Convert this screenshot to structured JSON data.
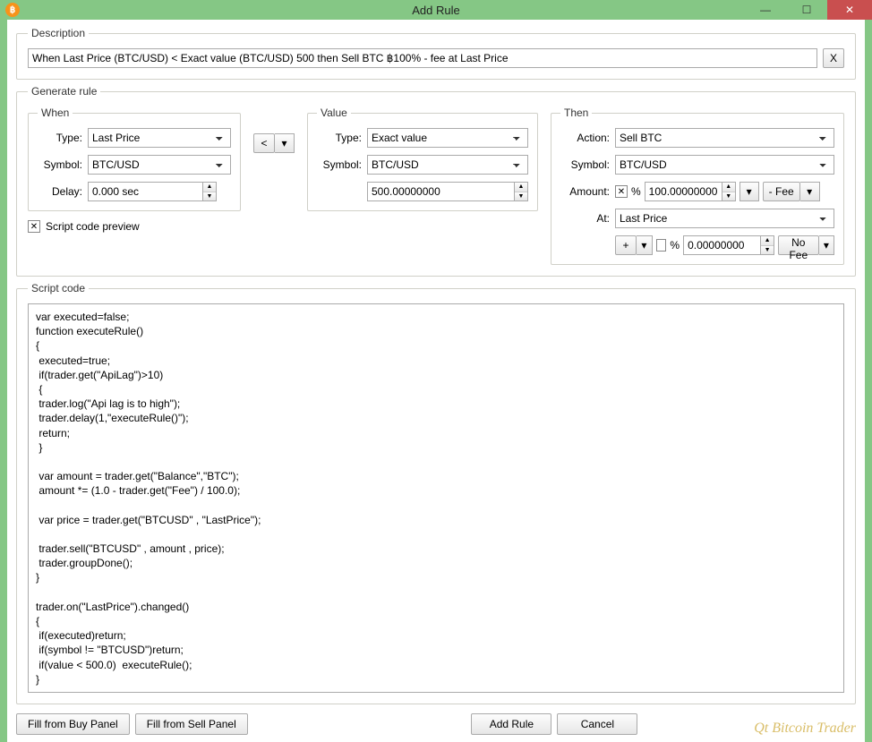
{
  "window": {
    "title": "Add Rule"
  },
  "description": {
    "legend": "Description",
    "text": "When Last Price (BTC/USD) < Exact value (BTC/USD) 500 then Sell BTC ฿100% - fee at Last Price",
    "x_button": "X"
  },
  "generate": {
    "legend": "Generate rule",
    "when": {
      "legend": "When",
      "type_label": "Type:",
      "type_value": "Last Price",
      "symbol_label": "Symbol:",
      "symbol_value": "BTC/USD",
      "delay_label": "Delay:",
      "delay_value": "0.000 sec"
    },
    "comparator": "<",
    "value": {
      "legend": "Value",
      "type_label": "Type:",
      "type_value": "Exact value",
      "symbol_label": "Symbol:",
      "symbol_value": "BTC/USD",
      "number": "500.00000000"
    },
    "then": {
      "legend": "Then",
      "action_label": "Action:",
      "action_value": "Sell BTC",
      "symbol_label": "Symbol:",
      "symbol_value": "BTC/USD",
      "amount_label": "Amount:",
      "amount_pct_checked": true,
      "amount_pct_symbol": "%",
      "amount_value": "100.00000000",
      "fee_btn": "- Fee",
      "at_label": "At:",
      "at_value": "Last Price",
      "plus_btn": "+",
      "extra_pct_checked": false,
      "extra_pct_symbol": "%",
      "extra_value": "0.00000000",
      "nofee_btn": "No Fee"
    },
    "preview_label": "Script code preview"
  },
  "script": {
    "legend": "Script code",
    "code": "var executed=false;\nfunction executeRule()\n{\n executed=true;\n if(trader.get(\"ApiLag\")>10)\n {\n trader.log(\"Api lag is to high\");\n trader.delay(1,\"executeRule()\");\n return;\n }\n\n var amount = trader.get(\"Balance\",\"BTC\");\n amount *= (1.0 - trader.get(\"Fee\") / 100.0);\n\n var price = trader.get(\"BTCUSD\" , \"LastPrice\");\n\n trader.sell(\"BTCUSD\" , amount , price);\n trader.groupDone();\n}\n\ntrader.on(\"LastPrice\").changed()\n{\n if(executed)return;\n if(symbol != \"BTCUSD\")return;\n if(value < 500.0)  executeRule();\n}"
  },
  "footer": {
    "fill_buy": "Fill from Buy Panel",
    "fill_sell": "Fill from Sell Panel",
    "add_rule": "Add Rule",
    "cancel": "Cancel"
  },
  "branding": "Qt Bitcoin Trader"
}
